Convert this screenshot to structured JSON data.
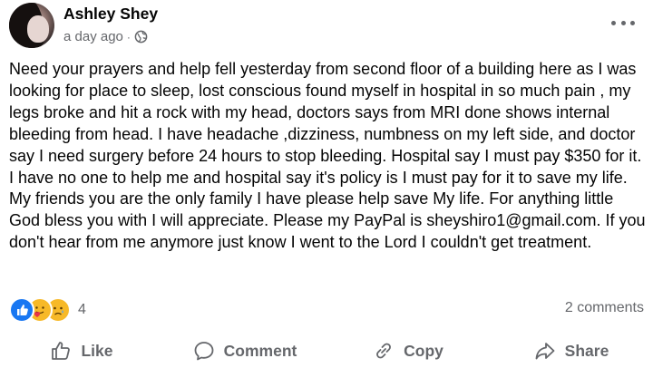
{
  "post": {
    "author": "Ashley Shey",
    "time": "a day ago",
    "separator": "·",
    "privacy_icon": "globe-icon",
    "more_icon": "more-options-icon",
    "text": "Need your prayers and help fell yesterday from second floor of a building here as I was looking for place to sleep, lost conscious found myself in hospital in so much pain , my legs broke and hit a rock with my head, doctors says from MRI done shows internal bleeding from head. I have headache ,dizziness, numbness on my left side, and doctor say I need surgery before 24 hours to stop bleeding. Hospital say I must pay $350 for it. I have no one to help me and hospital say it's policy is I must pay for it to save my life. My friends you are the only family I have please help save My life. For anything little God bless you with I will appreciate. Please my PayPal is sheyshiro1@gmail.com. If you don't hear from me anymore just know I went to the Lord I couldn't get treatment."
  },
  "reactions": {
    "types": [
      "like",
      "care",
      "sad"
    ],
    "count": "4",
    "comments": "2 comments"
  },
  "actions": {
    "like": "Like",
    "comment": "Comment",
    "copy": "Copy",
    "share": "Share"
  },
  "colors": {
    "text": "#050505",
    "secondary": "#65676b",
    "like_blue": "#1877f2",
    "reaction_yellow": "#f7b928"
  }
}
